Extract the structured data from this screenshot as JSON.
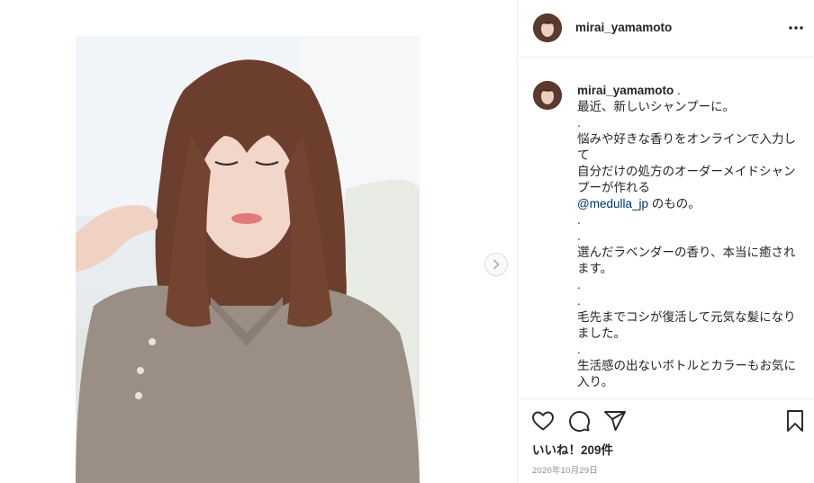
{
  "post": {
    "username": "mirai_yamamoto",
    "caption_username": "mirai_yamamoto",
    "caption_lines": [
      " .\n最近、新しいシャンプーに。\n.\n悩みや好きな香りをオンラインで入力して\n自分だけの処方のオーダーメイドシャンプーが作れる\n",
      "@medulla_jp",
      " のもの。\n.\n.\n選んだラベンダーの香り、本当に癒されます。\n.\n.\n毛先までコシが復活して元気な髪になりました。\n.\n生活感の出ないボトルとカラーもお気に入り。"
    ],
    "likes_text": "いいね！209件",
    "date_text": "2020年10月29日"
  },
  "icons": {
    "more": "more-options-icon",
    "next": "chevron-right-icon",
    "like": "heart-icon",
    "comment": "comment-icon",
    "share": "paper-plane-icon",
    "save": "bookmark-icon"
  },
  "colors": {
    "text": "#262626",
    "secondary": "#8e8e8e",
    "link": "#00376b",
    "border": "#efefef"
  }
}
